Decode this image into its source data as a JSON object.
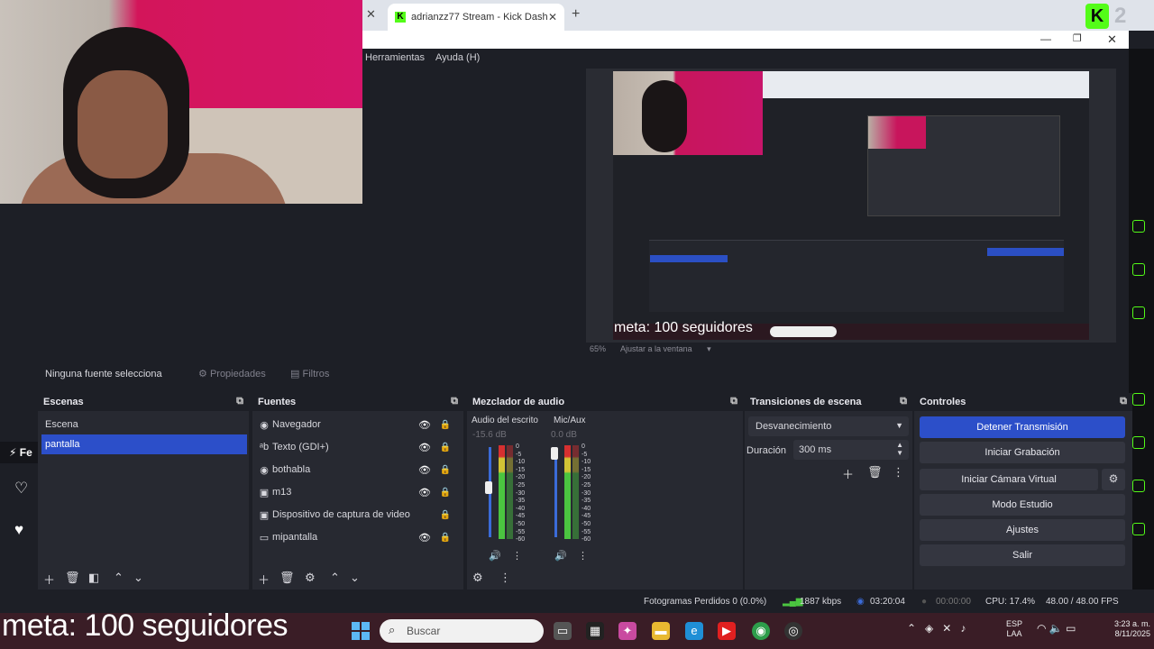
{
  "browser": {
    "tab_title": "adrianzz77 Stream - Kick Dashb",
    "kick_count": "2"
  },
  "obs_menu": {
    "tools": "Herramientas",
    "help": "Ayuda (H)"
  },
  "preview": {
    "goal_text": "meta: 100 seguidores",
    "zoom": "65%",
    "fit": "Ajustar a la ventana"
  },
  "source_toolbar": {
    "no_source": "Ninguna fuente selecciona",
    "properties": "Propiedades",
    "filters": "Filtros"
  },
  "scenes": {
    "title": "Escenas",
    "items": [
      "Escena",
      "pantalla"
    ],
    "active_index": 1
  },
  "sources": {
    "title": "Fuentes",
    "items": [
      {
        "name": "Navegador",
        "icon": "globe-icon"
      },
      {
        "name": "Texto (GDI+)",
        "icon": "text-icon"
      },
      {
        "name": "bothabla",
        "icon": "globe-icon"
      },
      {
        "name": "m13",
        "icon": "camera-icon"
      },
      {
        "name": "Dispositivo de captura de video",
        "icon": "camera-icon"
      },
      {
        "name": "mipantalla",
        "icon": "monitor-icon"
      }
    ]
  },
  "mixer": {
    "title": "Mezclador de audio",
    "channels": [
      {
        "name": "Audio del escrito",
        "db": "-15.6 dB",
        "fader_level": 0.58
      },
      {
        "name": "Mic/Aux",
        "db": "0.0 dB",
        "fader_level": 1.0
      }
    ],
    "scale": [
      "0",
      "-5",
      "-10",
      "-15",
      "-20",
      "-25",
      "-30",
      "-35",
      "-40",
      "-45",
      "-50",
      "-55",
      "-60"
    ]
  },
  "transitions": {
    "title": "Transiciones de escena",
    "selected": "Desvanecimiento",
    "duration_label": "Duración",
    "duration_value": "300 ms"
  },
  "controls": {
    "title": "Controles",
    "stop_stream": "Detener Transmisión",
    "start_recording": "Iniciar Grabación",
    "start_virtual_cam": "Iniciar Cámara Virtual",
    "studio_mode": "Modo Estudio",
    "settings": "Ajustes",
    "exit": "Salir"
  },
  "status": {
    "dropped_frames": "Fotogramas Perdidos 0 (0.0%)",
    "bitrate": "1887 kbps",
    "live_time": "03:20:04",
    "rec_time": "00:00:00",
    "cpu": "CPU: 17.4%",
    "fps": "48.00 / 48.00 FPS"
  },
  "side": {
    "label": "Fe"
  },
  "taskbar": {
    "goal_text": "meta: 100 seguidores",
    "search_placeholder": "Buscar",
    "lang_1": "ESP",
    "lang_2": "LAA",
    "time": "3:23 a. m.",
    "date": "8/11/2025"
  },
  "colors": {
    "accent": "#2c4fc9",
    "kick_green": "#53fc18",
    "meter_green": "#4bc540",
    "taskbar": "#3a1d26"
  }
}
